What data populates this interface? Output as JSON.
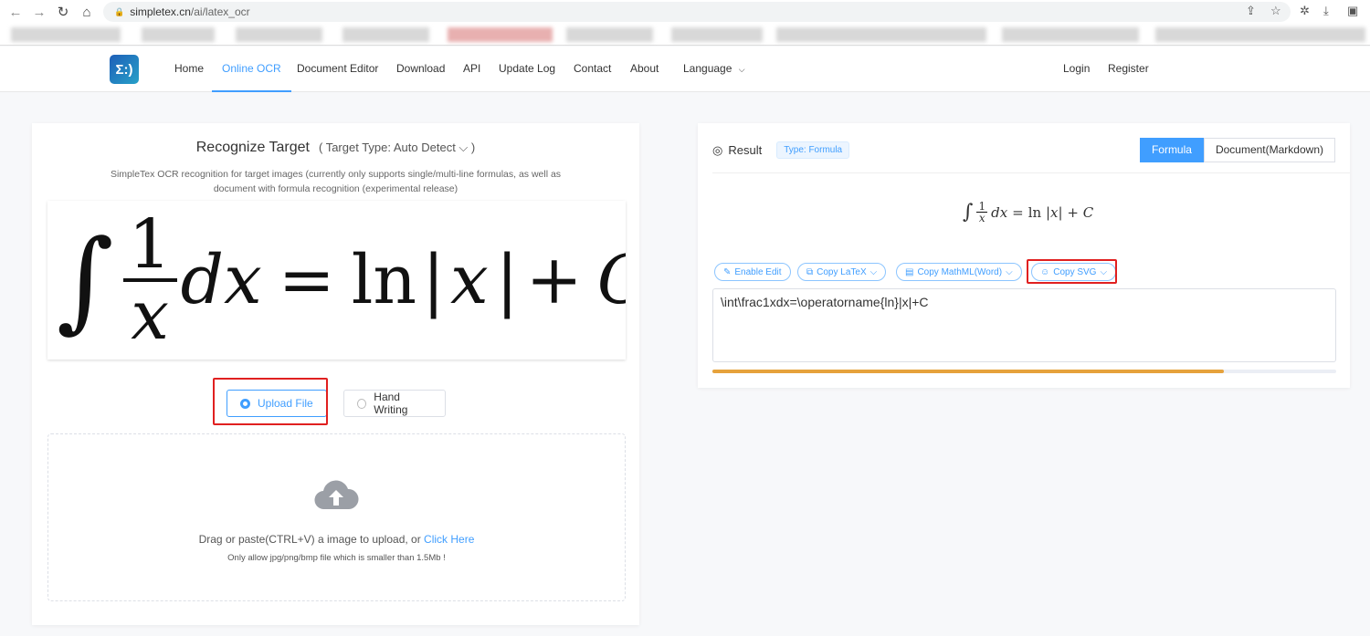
{
  "browser": {
    "url_host": "simpletex.cn",
    "url_path": "/ai/latex_ocr"
  },
  "nav": {
    "logo": "Σ:)",
    "items": [
      "Home",
      "Online OCR",
      "Document Editor",
      "Download",
      "API",
      "Update Log",
      "Contact",
      "About"
    ],
    "language": "Language",
    "login": "Login",
    "register": "Register"
  },
  "left": {
    "title": "Recognize Target",
    "target_type": "( Target Type: Auto Detect ⌵ )",
    "description": "SimpleTex OCR recognition for target images (currently only supports single/multi-line formulas, as well as document with formula recognition (experimental release)",
    "upload_file": "Upload File",
    "hand_writing": "Hand Writing",
    "drop_text": "Drag or paste(CTRL+V) a image to upload, or ",
    "click_here": "Click Here",
    "limit": "Only allow jpg/png/bmp file which is smaller than 1.5Mb !"
  },
  "right": {
    "result": "Result",
    "type_tag": "Type: Formula",
    "tab_formula": "Formula",
    "tab_document": "Document(Markdown)",
    "enable_edit": "Enable Edit",
    "copy_latex": "Copy LaTeX",
    "copy_mathml": "Copy MathML(Word)",
    "copy_svg": "Copy SVG",
    "latex": "\\int\\frac1xdx=\\operatorname{ln}|x|+C",
    "progress_percent": 82
  },
  "colors": {
    "accent": "#409eff",
    "progress": "#e6a23c",
    "highlight": "#e02020"
  }
}
